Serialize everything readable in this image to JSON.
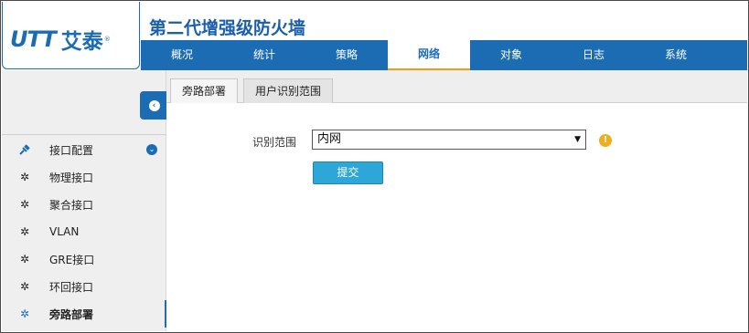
{
  "brand": {
    "logo_latin": "UTT",
    "logo_cn": "艾泰",
    "logo_mark": "®"
  },
  "app_title": "第二代增强级防火墙",
  "topnav": [
    {
      "label": "概况"
    },
    {
      "label": "统计"
    },
    {
      "label": "策略"
    },
    {
      "label": "网络",
      "active": true
    },
    {
      "label": "对象"
    },
    {
      "label": "日志"
    },
    {
      "label": "系统"
    }
  ],
  "sidebar": {
    "collapse_icon": "chevron-left-circle-icon",
    "items": [
      {
        "label": "接口配置",
        "icon": "plug-icon",
        "expanded": true
      },
      {
        "label": "物理接口",
        "icon": "gear-icon"
      },
      {
        "label": "聚合接口",
        "icon": "gear-icon"
      },
      {
        "label": "VLAN",
        "icon": "gear-icon"
      },
      {
        "label": "GRE接口",
        "icon": "gear-icon"
      },
      {
        "label": "环回接口",
        "icon": "gear-icon"
      },
      {
        "label": "旁路部署",
        "icon": "gear-icon",
        "active": true
      }
    ]
  },
  "tabs": [
    {
      "label": "旁路部署"
    },
    {
      "label": "用户识别范围",
      "active": true
    }
  ],
  "form": {
    "range_label": "识别范围",
    "range_value": "内网",
    "submit_label": "提交",
    "warn_icon": "!"
  },
  "colors": {
    "primary": "#1b6cb3",
    "accent": "#f39c12",
    "button": "#2da7d7"
  }
}
